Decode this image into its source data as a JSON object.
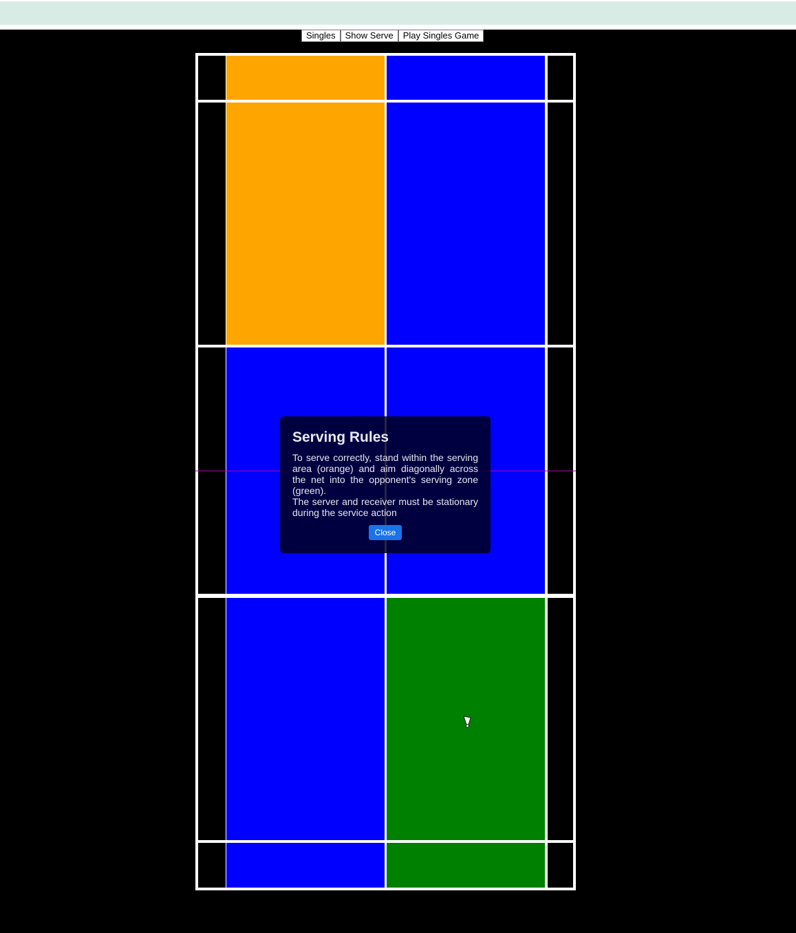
{
  "toolbar": {
    "buttons": [
      "Singles",
      "Show Serve",
      "Play Singles Game"
    ]
  },
  "court": {
    "colors": {
      "lines": "#ffffff",
      "alley": "#000000",
      "serving_area": "#ffa500",
      "neutral_zone": "#0000ff",
      "target_zone": "#008000",
      "net": "#b000b0"
    }
  },
  "modal": {
    "title": "Serving Rules",
    "paragraph1": "To serve correctly, stand within the serving area (orange) and aim diagonally across the net into the opponent's serving zone (green).",
    "paragraph2": "The server and receiver must be stationary during the service action",
    "close_label": "Close"
  },
  "shuttlecock": {
    "icon": "shuttlecock-icon"
  }
}
